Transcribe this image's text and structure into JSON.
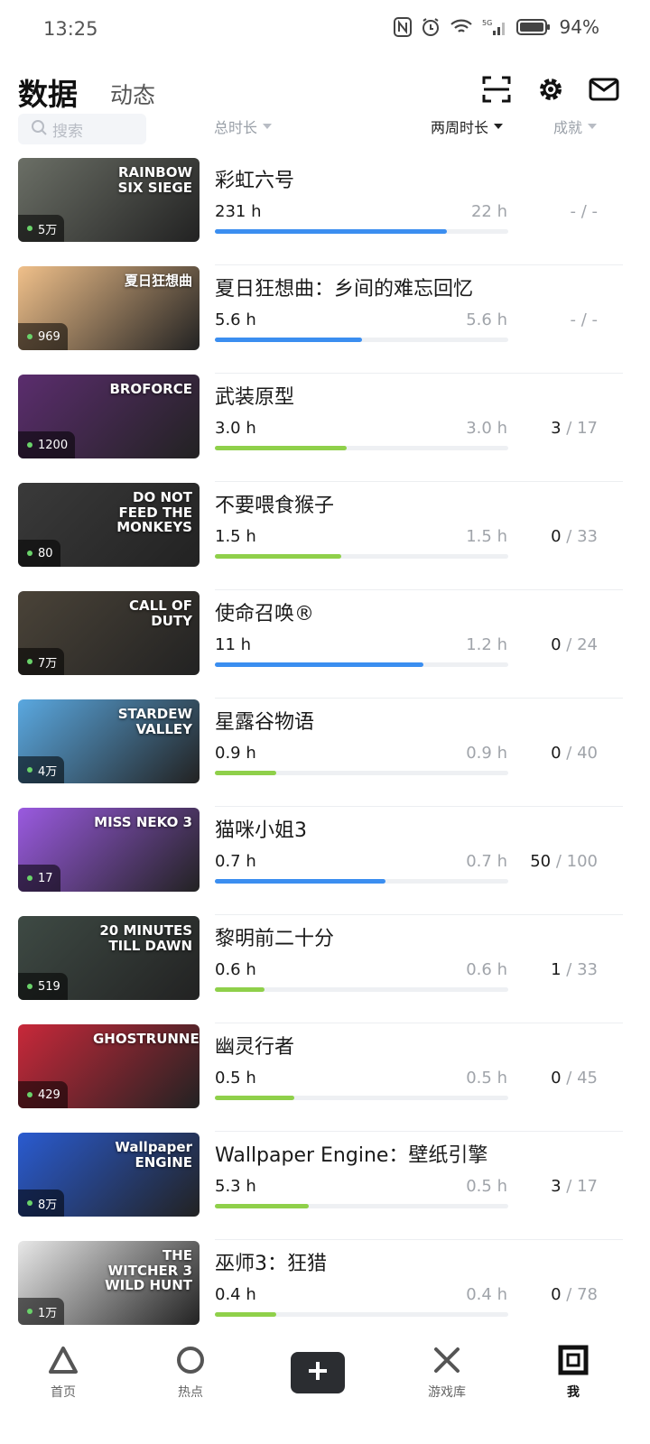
{
  "status": {
    "time": "13:25",
    "battery": "94%"
  },
  "header": {
    "tab_active": "数据",
    "tab_inactive": "动态"
  },
  "filters": {
    "search_placeholder": "搜索",
    "total": "总时长",
    "two_week": "两周时长",
    "achievements": "成就"
  },
  "games": [
    {
      "title": "彩虹六号",
      "cover_text": "RAINBOW SIX SIEGE",
      "owners": "5万",
      "total": "231 h",
      "two_week": "22 h",
      "ach_got": "",
      "ach_rest": "- / -",
      "bar": 0.79,
      "bar_color": "#3b8ef0",
      "cover_bg": "#6b6f66"
    },
    {
      "title": "夏日狂想曲：乡间的难忘回忆",
      "cover_text": "夏日狂想曲",
      "owners": "969",
      "total": "5.6 h",
      "two_week": "5.6 h",
      "ach_got": "",
      "ach_rest": "- / -",
      "bar": 0.5,
      "bar_color": "#3b8ef0",
      "cover_bg": "#f0c08a"
    },
    {
      "title": "武装原型",
      "cover_text": "BROFORCE",
      "owners": "1200",
      "total": "3.0 h",
      "two_week": "3.0 h",
      "ach_got": "3",
      "ach_rest": " / 17",
      "bar": 0.45,
      "bar_color": "#8fd04a",
      "cover_bg": "#5b2d6e"
    },
    {
      "title": "不要喂食猴子",
      "cover_text": "DO NOT FEED THE MONKEYS",
      "owners": "80",
      "total": "1.5 h",
      "two_week": "1.5 h",
      "ach_got": "0",
      "ach_rest": " / 33",
      "bar": 0.43,
      "bar_color": "#8fd04a",
      "cover_bg": "#3a3a3a"
    },
    {
      "title": "使命召唤®",
      "cover_text": "CALL OF DUTY",
      "owners": "7万",
      "total": "11 h",
      "two_week": "1.2 h",
      "ach_got": "0",
      "ach_rest": " / 24",
      "bar": 0.71,
      "bar_color": "#3b8ef0",
      "cover_bg": "#4a4338"
    },
    {
      "title": "星露谷物语",
      "cover_text": "STARDEW VALLEY",
      "owners": "4万",
      "total": "0.9 h",
      "two_week": "0.9 h",
      "ach_got": "0",
      "ach_rest": " / 40",
      "bar": 0.21,
      "bar_color": "#8fd04a",
      "cover_bg": "#5aa8e0"
    },
    {
      "title": "猫咪小姐3",
      "cover_text": "MISS NEKO 3",
      "owners": "17",
      "total": "0.7 h",
      "two_week": "0.7 h",
      "ach_got": "50",
      "ach_rest": " / 100",
      "bar": 0.58,
      "bar_color": "#3b8ef0",
      "cover_bg": "#9a5ae0"
    },
    {
      "title": "黎明前二十分",
      "cover_text": "20 MINUTES TILL DAWN",
      "owners": "519",
      "total": "0.6 h",
      "two_week": "0.6 h",
      "ach_got": "1",
      "ach_rest": " / 33",
      "bar": 0.17,
      "bar_color": "#8fd04a",
      "cover_bg": "#3e4a44"
    },
    {
      "title": "幽灵行者",
      "cover_text": "GHOSTRUNNER",
      "owners": "429",
      "total": "0.5 h",
      "two_week": "0.5 h",
      "ach_got": "0",
      "ach_rest": " / 45",
      "bar": 0.27,
      "bar_color": "#8fd04a",
      "cover_bg": "#c8283a"
    },
    {
      "title": "Wallpaper Engine：壁纸引擎",
      "cover_text": "Wallpaper ENGINE",
      "owners": "8万",
      "total": "5.3 h",
      "two_week": "0.5 h",
      "ach_got": "3",
      "ach_rest": " / 17",
      "bar": 0.32,
      "bar_color": "#8fd04a",
      "cover_bg": "#2a5bd0"
    },
    {
      "title": "巫师3：狂猎",
      "cover_text": "THE WITCHER 3 WILD HUNT",
      "owners": "1万",
      "total": "0.4 h",
      "two_week": "0.4 h",
      "ach_got": "0",
      "ach_rest": " / 78",
      "bar": 0.21,
      "bar_color": "#8fd04a",
      "cover_bg": "#e8e8e8"
    }
  ],
  "nav": {
    "home": "首页",
    "hot": "热点",
    "library": "游戏库",
    "me": "我"
  }
}
